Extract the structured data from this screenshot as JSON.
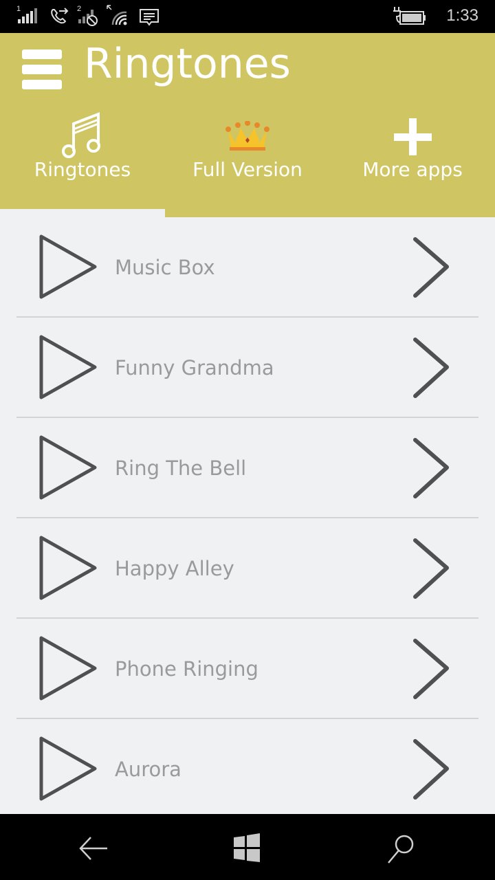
{
  "status_bar": {
    "sim1_label": "1",
    "sim2_label": "2",
    "time": "1:33",
    "icons": [
      "signal-sim1-icon",
      "call-forwarding-icon",
      "signal-sim2-no-service-icon",
      "wifi-icon",
      "message-icon",
      "battery-charging-icon"
    ]
  },
  "header": {
    "title": "Ringtones",
    "menu_icon": "hamburger-icon",
    "background_color": "#cfc663",
    "tabs": [
      {
        "label": "Ringtones",
        "icon": "music-note-icon",
        "selected": true
      },
      {
        "label": "Full Version",
        "icon": "crown-icon",
        "selected": false
      },
      {
        "label": "More apps",
        "icon": "plus-icon",
        "selected": false
      }
    ]
  },
  "ringtones": [
    {
      "name": "Music Box"
    },
    {
      "name": "Funny Grandma"
    },
    {
      "name": "Ring The Bell"
    },
    {
      "name": "Happy Alley"
    },
    {
      "name": "Phone Ringing"
    },
    {
      "name": "Aurora"
    }
  ],
  "nav_bar": {
    "buttons": [
      "back-arrow-icon",
      "windows-start-icon",
      "search-icon"
    ]
  }
}
